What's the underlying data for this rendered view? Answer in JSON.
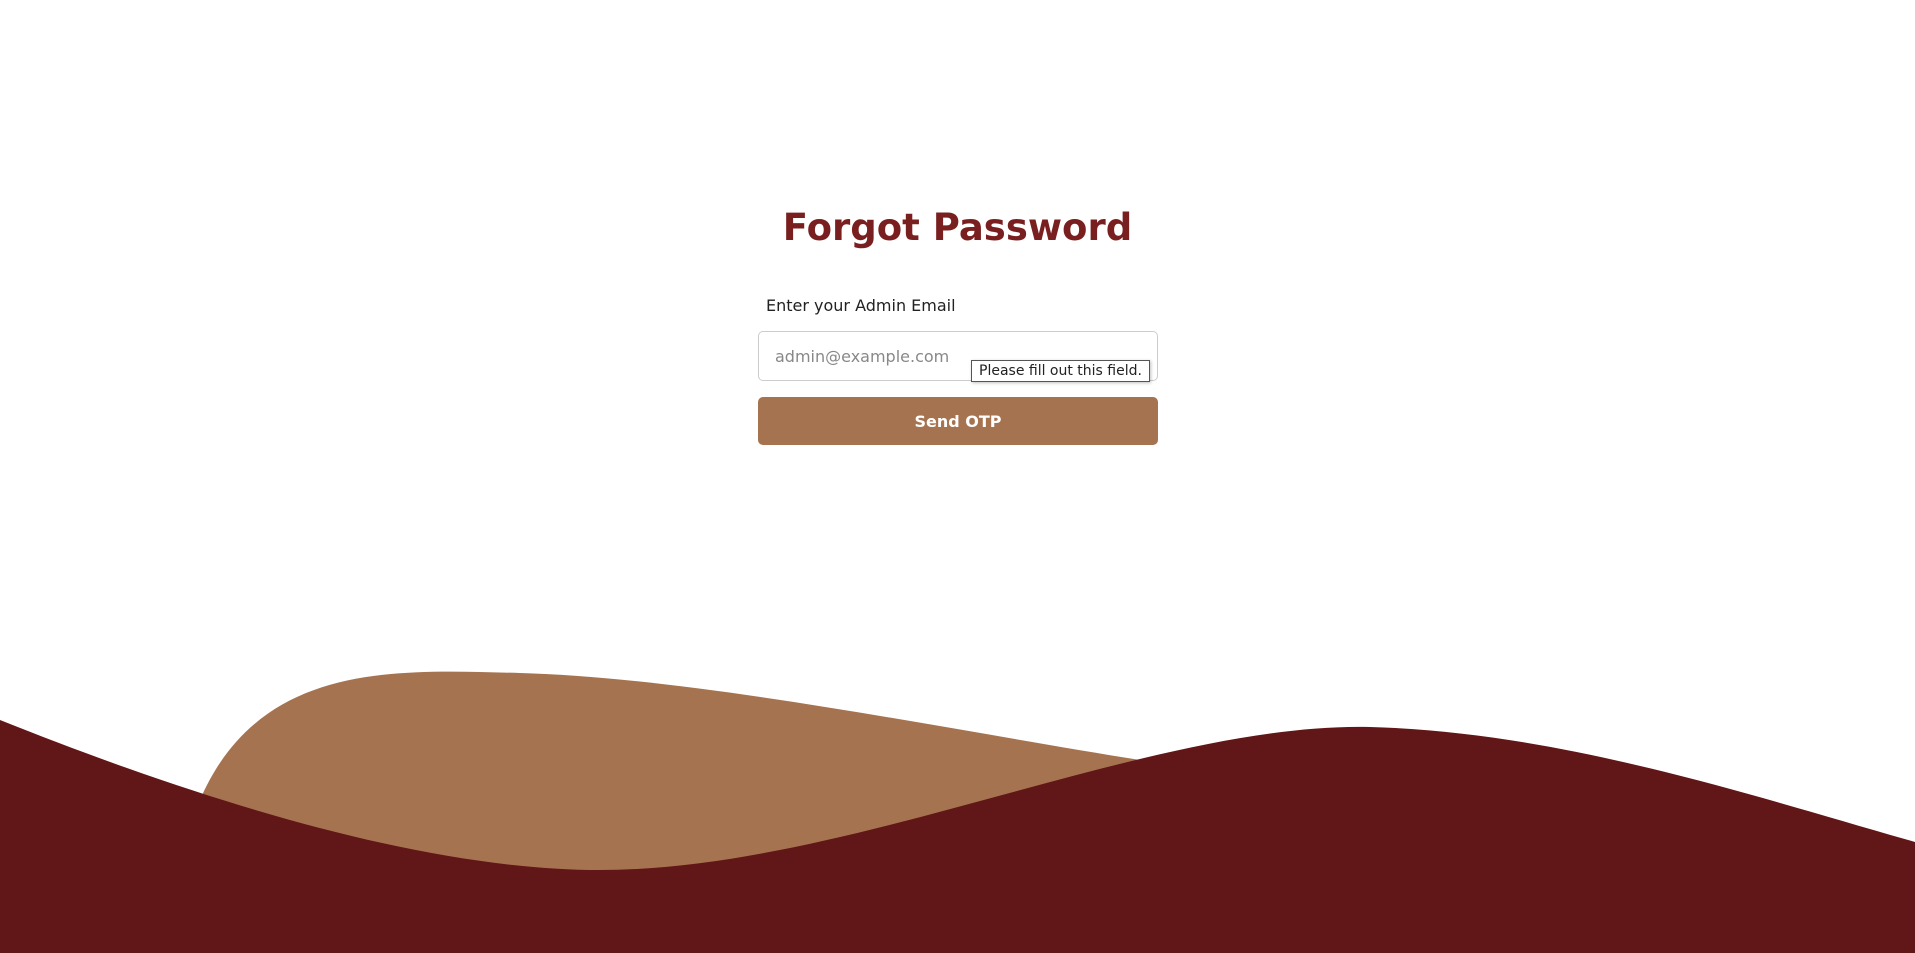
{
  "page": {
    "title": "Forgot Password"
  },
  "form": {
    "email_label": "Enter your Admin Email",
    "email_value": "",
    "email_placeholder": "admin@example.com",
    "validation_tooltip": "Please fill out this field.",
    "submit_label": "Send OTP"
  },
  "colors": {
    "title": "#7a1f1f",
    "button": "#a67350",
    "wave_back": "#a67350",
    "wave_front": "#611618"
  }
}
